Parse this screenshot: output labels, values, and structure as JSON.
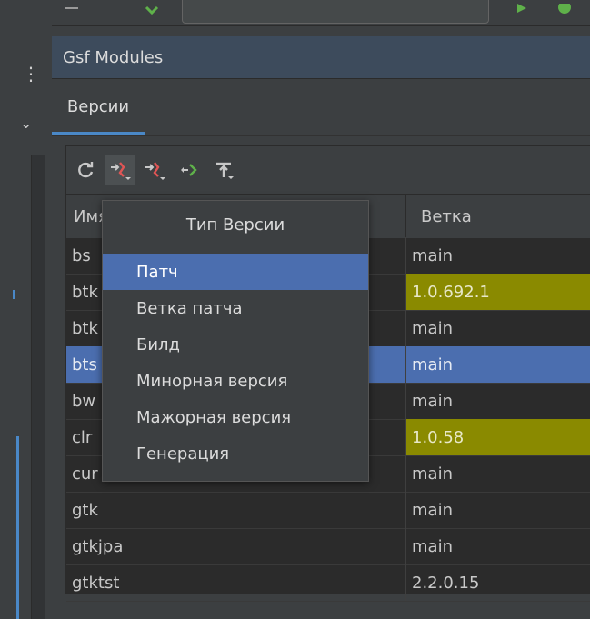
{
  "app": {
    "header_title": "Gsf Modules"
  },
  "tabs": [
    {
      "label": "Версии"
    }
  ],
  "table": {
    "columns": {
      "name": "Имя",
      "branch": "Ветка"
    },
    "rows": [
      {
        "name": "bs",
        "branch": "main",
        "version": false,
        "selected": false
      },
      {
        "name": "btk",
        "branch": "1.0.692.1",
        "version": true,
        "selected": false
      },
      {
        "name": "btk",
        "branch": "main",
        "version": false,
        "selected": false
      },
      {
        "name": "bts",
        "branch": "main",
        "version": false,
        "selected": true
      },
      {
        "name": "bw",
        "branch": "main",
        "version": false,
        "selected": false
      },
      {
        "name": "clr",
        "branch": "1.0.58",
        "version": true,
        "selected": false
      },
      {
        "name": "cur",
        "branch": "main",
        "version": false,
        "selected": false
      },
      {
        "name": "gtk",
        "branch": "main",
        "version": false,
        "selected": false
      },
      {
        "name": "gtkjpa",
        "branch": "main",
        "version": false,
        "selected": false
      },
      {
        "name": "gtktst",
        "branch": "2.2.0.15",
        "version": false,
        "selected": false
      }
    ]
  },
  "popup": {
    "title": "Тип Версии",
    "items": [
      {
        "label": "Патч",
        "selected": true
      },
      {
        "label": "Ветка патча",
        "selected": false
      },
      {
        "label": "Билд",
        "selected": false
      },
      {
        "label": "Минорная версия",
        "selected": false
      },
      {
        "label": "Мажорная версия",
        "selected": false
      },
      {
        "label": "Генерация",
        "selected": false
      }
    ]
  },
  "toolbar": {
    "icons": [
      "refresh-icon",
      "version-dropdown-icon",
      "version-down-icon",
      "version-up-icon",
      "push-top-icon"
    ]
  },
  "colors": {
    "accent": "#4a88c7",
    "selection": "#4b6eaf",
    "version_highlight": "#8a8a00",
    "header_bg": "#3d4b5c"
  }
}
